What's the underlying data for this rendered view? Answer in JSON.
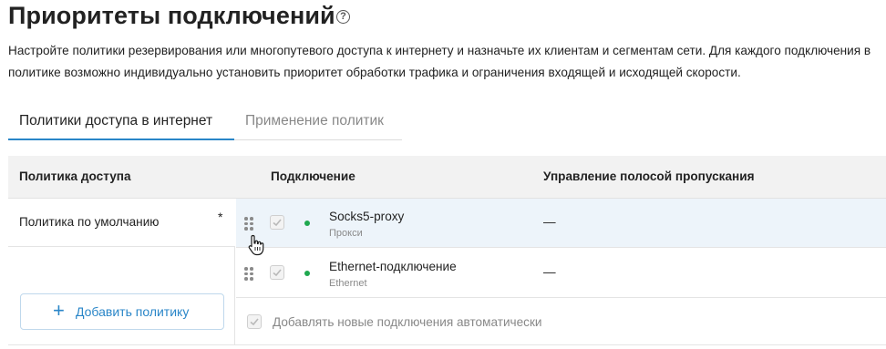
{
  "page": {
    "title": "Приоритеты подключений",
    "help_icon": "question-circle-icon",
    "description": "Настройте политики резервирования или многопутевого доступа к интернету и назначьте их клиентам и сегментам сети. Для каждого подключения в политике возможно индивидуально установить приоритет обработки трафика и ограничения входящей и исходящей скорости."
  },
  "tabs": [
    {
      "label": "Политики доступа в интернет",
      "active": true
    },
    {
      "label": "Применение политик",
      "active": false
    }
  ],
  "table": {
    "headers": {
      "policy": "Политика доступа",
      "connection": "Подключение",
      "bandwidth": "Управление полосой пропускания"
    }
  },
  "policies": [
    {
      "name": "Политика по умолчанию",
      "marker": "*"
    }
  ],
  "add_policy": {
    "icon": "plus-icon",
    "label": "Добавить политику"
  },
  "connections": [
    {
      "name": "Socks5-proxy",
      "type": "Прокси",
      "bandwidth": "—",
      "checked": true,
      "status": "online"
    },
    {
      "name": "Ethernet-подключение",
      "type": "Ethernet",
      "bandwidth": "—",
      "checked": true,
      "status": "online"
    }
  ],
  "auto_add": {
    "label": "Добавлять новые подключения автоматически",
    "checked": true
  },
  "colors": {
    "accent": "#2a86c8",
    "status_online": "#1fa84f",
    "row_highlight": "#edf4fa",
    "header_bg": "#f2f2f2"
  }
}
